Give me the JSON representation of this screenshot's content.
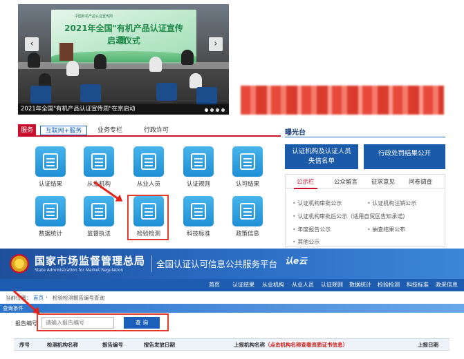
{
  "banner": {
    "stage_top": "中国有机产品认证宣传周",
    "stage_title": "2021年全国\"有机产品认证宣传周\"",
    "stage_sub": "启动仪式",
    "caption": "2021年全国\"有机产品认证宣传周\"在京启动",
    "prev": "‹",
    "next": "›"
  },
  "service": {
    "tag": "服务",
    "tabs": [
      "互联网+服务",
      "业务专栏",
      "行政许可"
    ],
    "tiles": [
      "认证结果",
      "从业机构",
      "从业人员",
      "认证规则",
      "认可结果",
      "数据统计",
      "监督执法",
      "检验检测",
      "科技标准",
      "政策信息"
    ]
  },
  "exposure": {
    "title": "曝光台",
    "btn_left": [
      "认证机构及认证人员",
      "失信名单"
    ],
    "btn_right": "行政处罚结果公开",
    "tabs": [
      "公示栏",
      "公众留言",
      "征求意见",
      "问卷调查"
    ],
    "items": [
      "认证机构审批公示",
      "认证机构注销公示",
      "认证机构审批后公示（适用自贸区告知承诺）",
      "年度报告公示",
      "抽查结果公布",
      "其他公示"
    ]
  },
  "site": {
    "org_cn": "国家市场监督管理总局",
    "org_en": "State Administration for Market Regulation",
    "platform": "全国认证认可信息公共服务平台",
    "platform_logo": "认e云",
    "nav": [
      "首页",
      "认证结果",
      "从业机构",
      "从业人员",
      "认证规则",
      "数据统计",
      "检验检测",
      "科技标准",
      "政采信息"
    ],
    "crumb_label": "当前位置：",
    "crumb_home": "首页",
    "crumb_sep": "›",
    "crumb_page": "检验检测报告编号查询",
    "query_title": "查询条件",
    "report_label": "报告编号",
    "report_placeholder": "请输入报告编号",
    "query_button": "查 询",
    "table_headers": {
      "no": "序号",
      "agency": "检测机构名称",
      "report_no": "报告编号",
      "date": "报告发放日期",
      "uploader": "上报机构名称",
      "uploader_note": "（点击机构名称查看资质证书信息）",
      "upload_date": "上报日期"
    }
  }
}
